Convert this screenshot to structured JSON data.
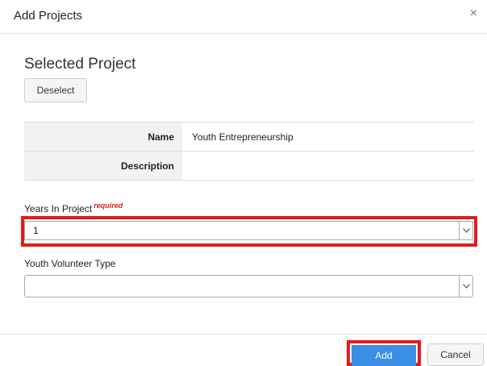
{
  "dialog": {
    "title": "Add Projects",
    "close_glyph": "×",
    "close_icon": "close-icon"
  },
  "selected_project": {
    "heading": "Selected Project",
    "deselect_label": "Deselect",
    "fields": [
      {
        "label": "Name",
        "value": "Youth Entrepreneurship"
      },
      {
        "label": "Description",
        "value": ""
      }
    ]
  },
  "years_in_project": {
    "label": "Years In Project",
    "required_text": "required",
    "value": "1"
  },
  "youth_volunteer_type": {
    "label": "Youth Volunteer Type",
    "value": ""
  },
  "footer": {
    "add_label": "Add",
    "cancel_label": "Cancel"
  },
  "colors": {
    "highlight": "#e21c1c",
    "primary": "#3a8ee6",
    "required": "#d9231d"
  }
}
